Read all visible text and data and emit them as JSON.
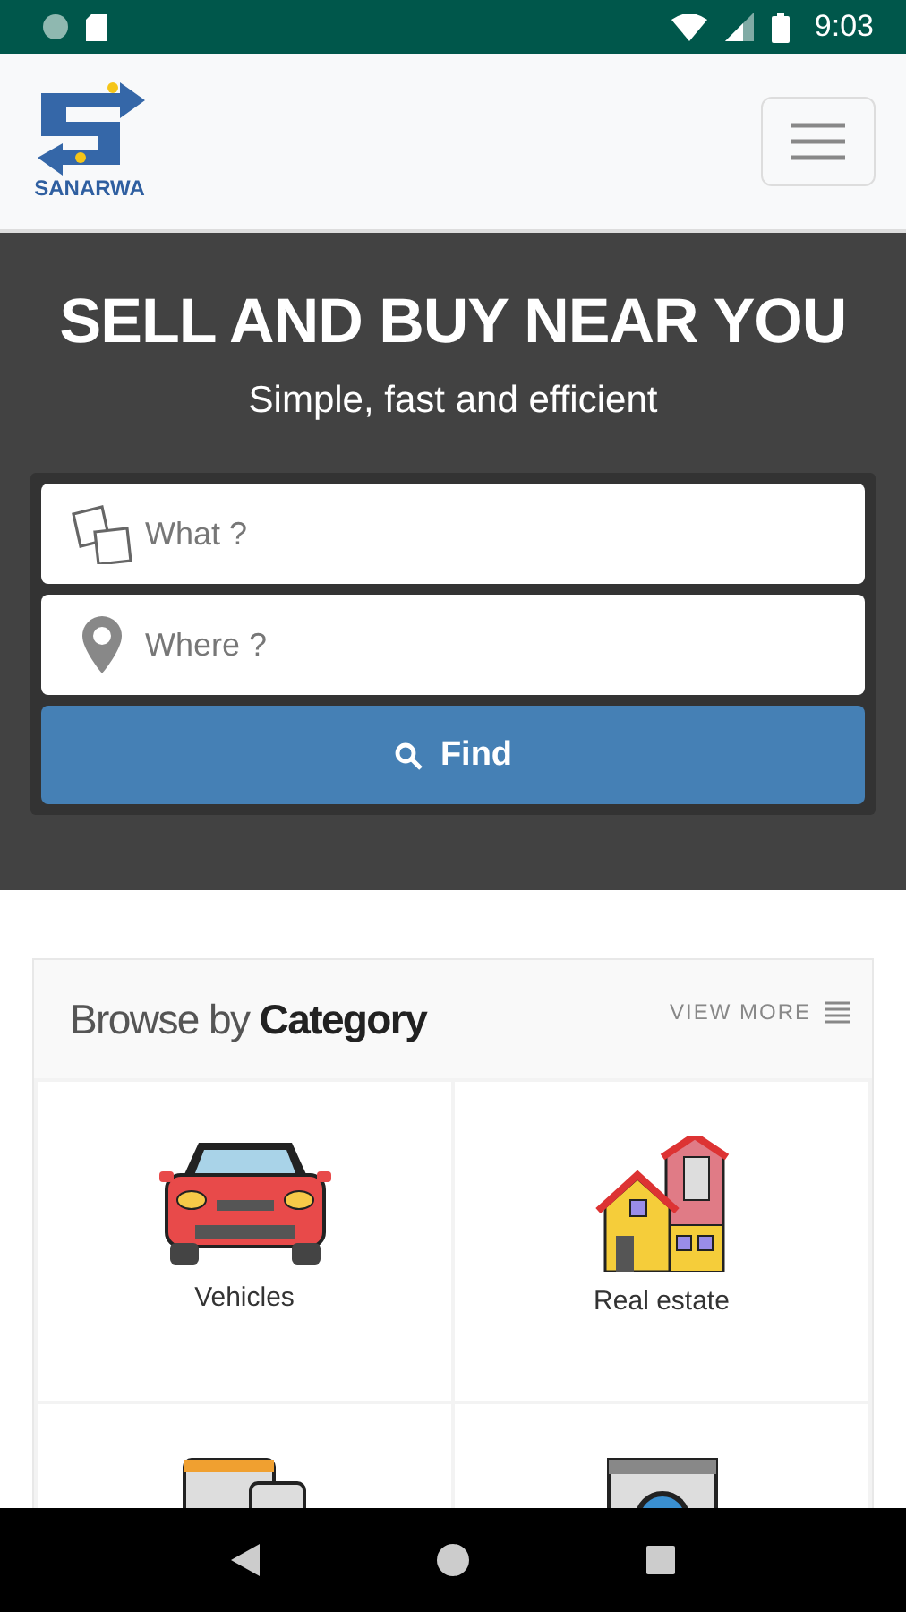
{
  "status_bar": {
    "time": "9:03"
  },
  "header": {
    "logo_text": "SANARWA"
  },
  "hero": {
    "title": "SELL AND BUY NEAR YOU",
    "subtitle": "Simple, fast and efficient"
  },
  "search": {
    "what": {
      "placeholder": "What ?"
    },
    "where": {
      "placeholder": "Where ?"
    },
    "button": "Find"
  },
  "categories_card": {
    "title_light": "Browse by",
    "title_bold": "Category",
    "view_more": "VIEW MORE",
    "items": [
      {
        "label": "Vehicles"
      },
      {
        "label": "Real estate"
      }
    ]
  }
}
